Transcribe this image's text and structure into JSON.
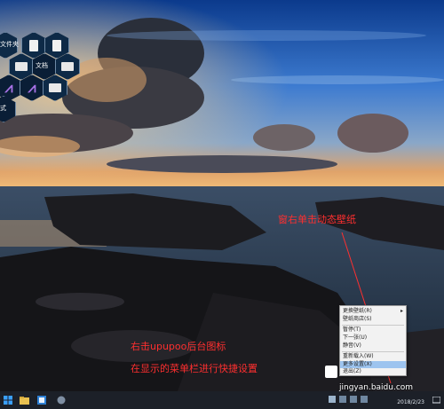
{
  "launcher": {
    "label_files": "文件夹",
    "label_docs": "文档",
    "label_bottom": "式"
  },
  "annotations": {
    "top": "窗右单击动态壁纸",
    "bottom_line1": "右击upupoo后台图标",
    "bottom_line2": "在显示的菜单栏进行快捷设置"
  },
  "context_menu": {
    "items": [
      "更换壁纸(R)",
      "壁纸商店(S)",
      "暂停(T)",
      "下一张(U)",
      "静音(V)",
      "重新载入(W)",
      "更多设置(X)",
      "退出(Z)"
    ],
    "highlighted_index": 6
  },
  "taskbar": {
    "date": "2018/2/23"
  },
  "watermark": {
    "text": "jingyan.baidu.com"
  },
  "colors": {
    "annotation": "#ff2f2f",
    "menu_highlight": "#9dc4ef",
    "taskbar": "#1c2028"
  }
}
